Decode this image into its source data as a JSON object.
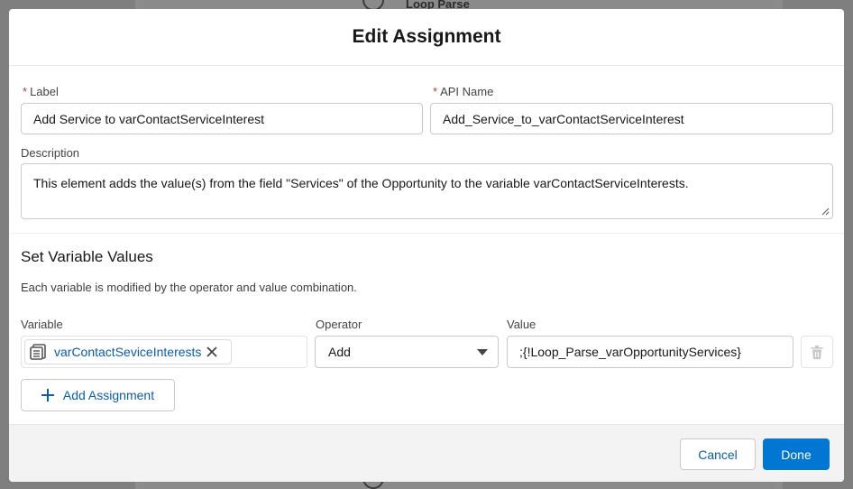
{
  "background": {
    "node_title": "Loop Parse"
  },
  "modal": {
    "title": "Edit Assignment"
  },
  "label_field": {
    "label": "Label",
    "required_marker": "*",
    "value": "Add Service to varContactServiceInterest"
  },
  "api_name_field": {
    "label": "API Name",
    "required_marker": "*",
    "value": "Add_Service_to_varContactServiceInterest"
  },
  "description_field": {
    "label": "Description",
    "value": "This element adds the value(s) from the field \"Services\" of the Opportunity to the variable varContactServiceInterests."
  },
  "section": {
    "title": "Set Variable Values",
    "description": "Each variable is modified by the operator and value combination."
  },
  "assignment_row": {
    "variable_header": "Variable",
    "operator_header": "Operator",
    "value_header": "Value",
    "variable_value": "varContactSeviceInterests",
    "variable_icon": "collection-variable-icon",
    "operator_value": "Add",
    "value_value": ";{!Loop_Parse_varOpportunityServices}"
  },
  "add_assignment_label": "Add Assignment",
  "footer": {
    "cancel_label": "Cancel",
    "done_label": "Done"
  },
  "colors": {
    "brand": "#0176d3",
    "link": "#0b5cab",
    "required": "#c23934"
  }
}
